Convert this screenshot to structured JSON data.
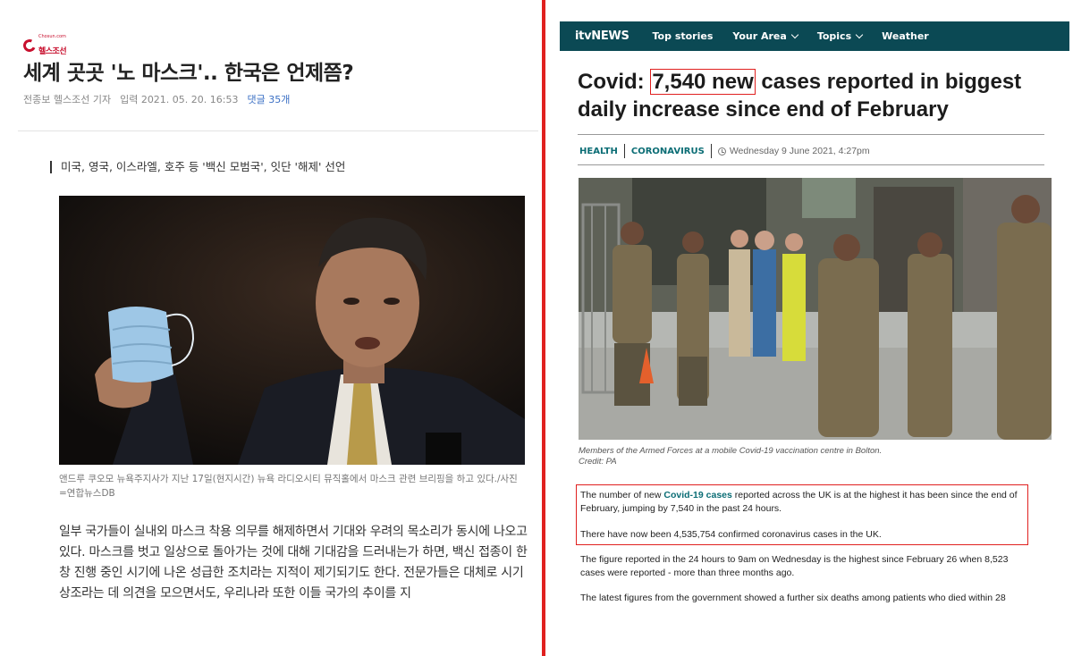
{
  "left_article": {
    "logo_top": "Chosun.com",
    "logo_name": "헬스조선",
    "title": "세계 곳곳 '노 마스크'.. 한국은 언제쯤?",
    "byline": "전종보 헬스조선 기자",
    "date": "입력 2021. 05. 20. 16:53",
    "comments": "댓글 35개",
    "subtitle": "미국, 영국, 이스라엘, 호주 등 '백신 모범국', 잇단 '해제' 선언",
    "caption": "앤드루 쿠오모 뉴욕주지사가 지난 17일(현지시간) 뉴욕 라디오시티 뮤직홀에서 마스크 관련 브리핑을 하고 있다./사진=연합뉴스DB",
    "body": "일부 국가들이 실내외 마스크 착용 의무를 해제하면서 기대와 우려의 목소리가 동시에 나오고 있다. 마스크를 벗고 일상으로 돌아가는 것에 대해 기대감을 드러내는가 하면, 백신 접종이 한창 진행 중인 시기에 나온 성급한 조치라는 지적이 제기되기도 한다. 전문가들은 대체로 시기상조라는 데 의견을 모으면서도, 우리나라 또한 이들 국가의 추이를 지"
  },
  "right_article": {
    "nav": {
      "logo": "itvNEWS",
      "items": [
        "Top stories",
        "Your Area",
        "Topics",
        "Weather"
      ]
    },
    "headline_pre": "Covid: ",
    "headline_highlight": "7,540 new",
    "headline_post": " cases reported in biggest daily increase since end of February",
    "tags": [
      "HEALTH",
      "CORONAVIRUS"
    ],
    "date": "Wednesday 9 June 2021, 4:27pm",
    "caption_line1": "Members of the Armed Forces at a mobile Covid-19 vaccination centre in Bolton.",
    "caption_line2": "Credit: PA",
    "p1_pre": "The number of new ",
    "p1_link": "Covid-19 cases",
    "p1_post": " reported across the UK is at the highest it has been since the end of February, jumping by 7,540 in the past 24 hours.",
    "p2": "There have now been 4,535,754 confirmed coronavirus cases in the UK.",
    "p3": "The figure reported in the 24 hours to 9am on Wednesday is the highest since February 26 when 8,523 cases were reported - more than three months ago.",
    "p4": "The latest figures from the government showed a further six deaths among patients who died within 28"
  },
  "colors": {
    "itv_teal": "#0b4954",
    "link_teal": "#0b6d75",
    "highlight_red": "#e0201f",
    "chosun_red": "#c8102e"
  }
}
